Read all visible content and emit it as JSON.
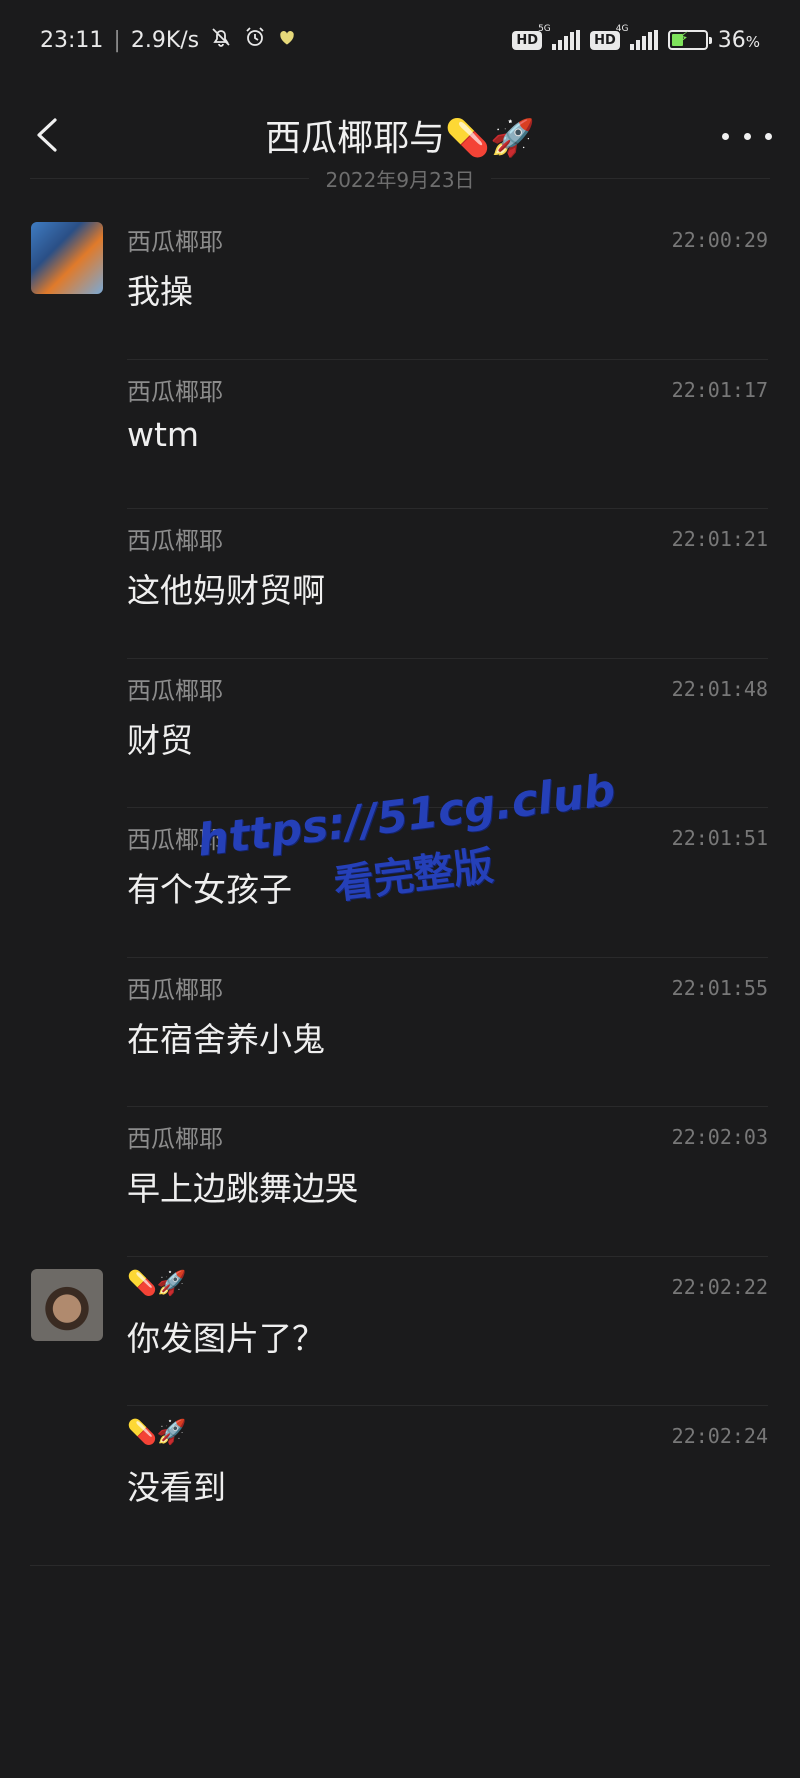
{
  "status_bar": {
    "time": "23:11",
    "speed": "2.9K/s",
    "mute_icon": "bell-off-icon",
    "alarm_icon": "alarm-icon",
    "heart_icon": "heart-icon",
    "hd1": "HD",
    "net1": "5G",
    "hd2": "HD",
    "net2": "4G",
    "battery_text": "36",
    "battery_level": 0.36
  },
  "header": {
    "title": "西瓜椰耶与💊🚀",
    "back_icon": "chevron-left-icon",
    "more_icon": "more-dots-icon"
  },
  "date": "2022年9月23日",
  "messages": [
    {
      "sender": "西瓜椰耶",
      "time": "22:00:29",
      "text": "我操"
    },
    {
      "sender": "西瓜椰耶",
      "time": "22:01:17",
      "text": "wtm"
    },
    {
      "sender": "西瓜椰耶",
      "time": "22:01:21",
      "text": "这他妈财贸啊"
    },
    {
      "sender": "西瓜椰耶",
      "time": "22:01:48",
      "text": "财贸"
    },
    {
      "sender": "西瓜椰耶",
      "time": "22:01:51",
      "text": "有个女孩子"
    },
    {
      "sender": "西瓜椰耶",
      "time": "22:01:55",
      "text": "在宿舍养小鬼"
    },
    {
      "sender": "西瓜椰耶",
      "time": "22:02:03",
      "text": "早上边跳舞边哭"
    },
    {
      "sender": "💊🚀",
      "time": "22:02:22",
      "text": "你发图片了？"
    },
    {
      "sender": "💊🚀",
      "time": "22:02:24",
      "text": "没看到"
    }
  ],
  "watermark": {
    "url": "https://51cg.club",
    "sub": "看完整版"
  },
  "colors": {
    "background": "#1b1b1c",
    "text": "#efefef",
    "secondary": "#8c8c8c",
    "watermark": "#2540b8"
  }
}
